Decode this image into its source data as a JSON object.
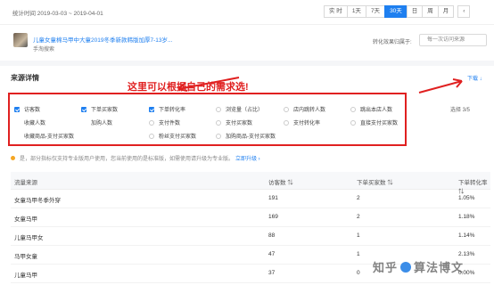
{
  "header": {
    "stat_time": "统计时间 2019-03-03 ~ 2019-04-01",
    "range_tabs": [
      {
        "label": "实 时",
        "active": false
      },
      {
        "label": "1天",
        "active": false
      },
      {
        "label": "7天",
        "active": false
      },
      {
        "label": "30天",
        "active": true
      },
      {
        "label": "日",
        "active": false
      },
      {
        "label": "周",
        "active": false
      },
      {
        "label": "月",
        "active": false
      },
      {
        "label": "‹",
        "active": false
      }
    ]
  },
  "product": {
    "title": "儿童女童棉马甲中大童2019冬季新款韩版加厚7-13岁...",
    "subtitle": "手淘搜索",
    "compare_label": "转化效果归属于:",
    "compare_value": "每一次访问来源"
  },
  "section": {
    "title": "来源详情",
    "annotation": "这里可以根据自己的需求选!",
    "download": "下载 ↓",
    "choose_count": "选择 3/5"
  },
  "metrics": [
    {
      "label": "访客数",
      "checked": true,
      "kind": "box"
    },
    {
      "label": "下单买家数",
      "checked": true,
      "kind": "box"
    },
    {
      "label": "下单转化率",
      "checked": true,
      "kind": "box"
    },
    {
      "label": "浏览量（占比）",
      "checked": false,
      "kind": "radio"
    },
    {
      "label": "店内跳转人数",
      "checked": false,
      "kind": "radio"
    },
    {
      "label": "跳出本店人数",
      "checked": false,
      "kind": "radio"
    },
    {
      "label": "收藏人数",
      "checked": false,
      "kind": "none"
    },
    {
      "label": "加购人数",
      "checked": false,
      "kind": "none"
    },
    {
      "label": "支付件数",
      "checked": false,
      "kind": "radio"
    },
    {
      "label": "支付买家数",
      "checked": false,
      "kind": "radio"
    },
    {
      "label": "支付转化率",
      "checked": false,
      "kind": "radio"
    },
    {
      "label": "直接支付买家数",
      "checked": false,
      "kind": "radio"
    },
    {
      "label": "收藏商品-支付买家数",
      "checked": false,
      "kind": "none"
    },
    {
      "label": "粉丝支付买家数",
      "checked": false,
      "kind": "radio"
    },
    {
      "label": "加购商品-支付买家数",
      "checked": false,
      "kind": "radio"
    }
  ],
  "notice": {
    "text": "是，部分指标仅支持专业版用户使用，您当前使用的是标准版，如需使用请升级为专业版。",
    "link": "立即升级 ›"
  },
  "table": {
    "headers": [
      "流量来源",
      "访客数 ⇅",
      "下单买家数 ⇅",
      "下单转化率 ⇅"
    ],
    "rows": [
      [
        "女童马甲冬季外穿",
        "191",
        "2",
        "1.05%"
      ],
      [
        "女童马甲",
        "169",
        "2",
        "1.18%"
      ],
      [
        "儿童马甲女",
        "88",
        "1",
        "1.14%"
      ],
      [
        "马甲女童",
        "47",
        "1",
        "2.13%"
      ],
      [
        "儿童马甲",
        "37",
        "0",
        "0.00%"
      ]
    ]
  },
  "watermark": {
    "text_left": "知乎",
    "text_right": "算法博文"
  }
}
